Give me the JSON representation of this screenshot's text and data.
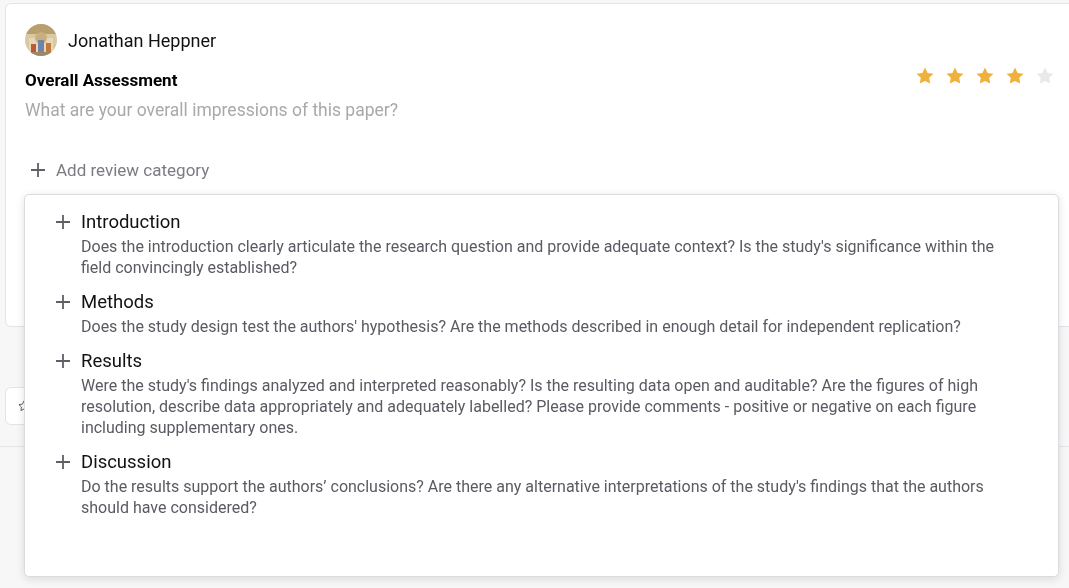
{
  "reviewer": {
    "name": "Jonathan Heppner"
  },
  "assessment": {
    "title": "Overall Assessment",
    "placeholder": "What are your overall impressions of this paper?",
    "stars": 4
  },
  "add_category": {
    "label": "Add review category"
  },
  "category_menu": [
    {
      "title": "Introduction",
      "description": "Does the introduction clearly articulate the research question and provide adequate context? Is the study's significance within the field convincingly established?"
    },
    {
      "title": "Methods",
      "description": "Does the study design test the authors' hypothesis? Are the methods described in enough detail for independent replication?"
    },
    {
      "title": "Results",
      "description": "Were the study's findings analyzed and interpreted reasonably? Is the resulting data open and auditable? Are the figures of high resolution, describe data appropriately and adequately labelled? Please provide comments - positive or negative on each figure including supplementary ones."
    },
    {
      "title": "Discussion",
      "description": "Do the results support the authors’ conclusions? Are there any alternative interpretations of the study's findings that the authors should have considered?"
    }
  ]
}
